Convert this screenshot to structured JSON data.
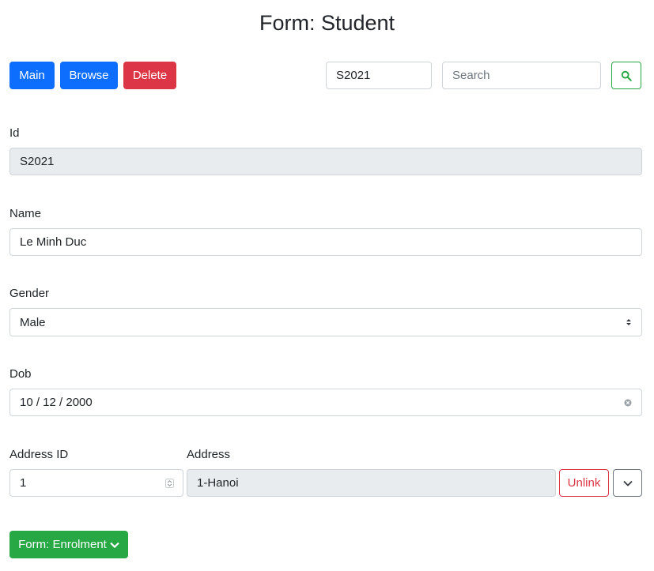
{
  "page": {
    "title": "Form: Student"
  },
  "toolbar": {
    "main_label": "Main",
    "browse_label": "Browse",
    "delete_label": "Delete",
    "id_search_value": "S2021",
    "search_placeholder": "Search"
  },
  "form": {
    "id": {
      "label": "Id",
      "value": "S2021"
    },
    "name": {
      "label": "Name",
      "value": "Le Minh Duc"
    },
    "gender": {
      "label": "Gender",
      "value": "Male",
      "options": [
        "Male"
      ]
    },
    "dob": {
      "label": "Dob",
      "value": "10 / 12 / 2000"
    },
    "address_id": {
      "label": "Address ID",
      "value": "1"
    },
    "address": {
      "label": "Address",
      "value": "1-Hanoi"
    },
    "unlink_label": "Unlink"
  },
  "subform": {
    "label": "Form: Enrolment"
  },
  "colors": {
    "primary": "#0d6efd",
    "danger": "#dc3545",
    "success": "#28a745",
    "readonly_bg": "#e9ecef"
  },
  "icons": {
    "search": "search-icon",
    "select_arrows": "select-arrows-icon",
    "clear": "clear-icon",
    "spinner": "spinner-icon",
    "chevron_down": "chevron-down-icon"
  }
}
